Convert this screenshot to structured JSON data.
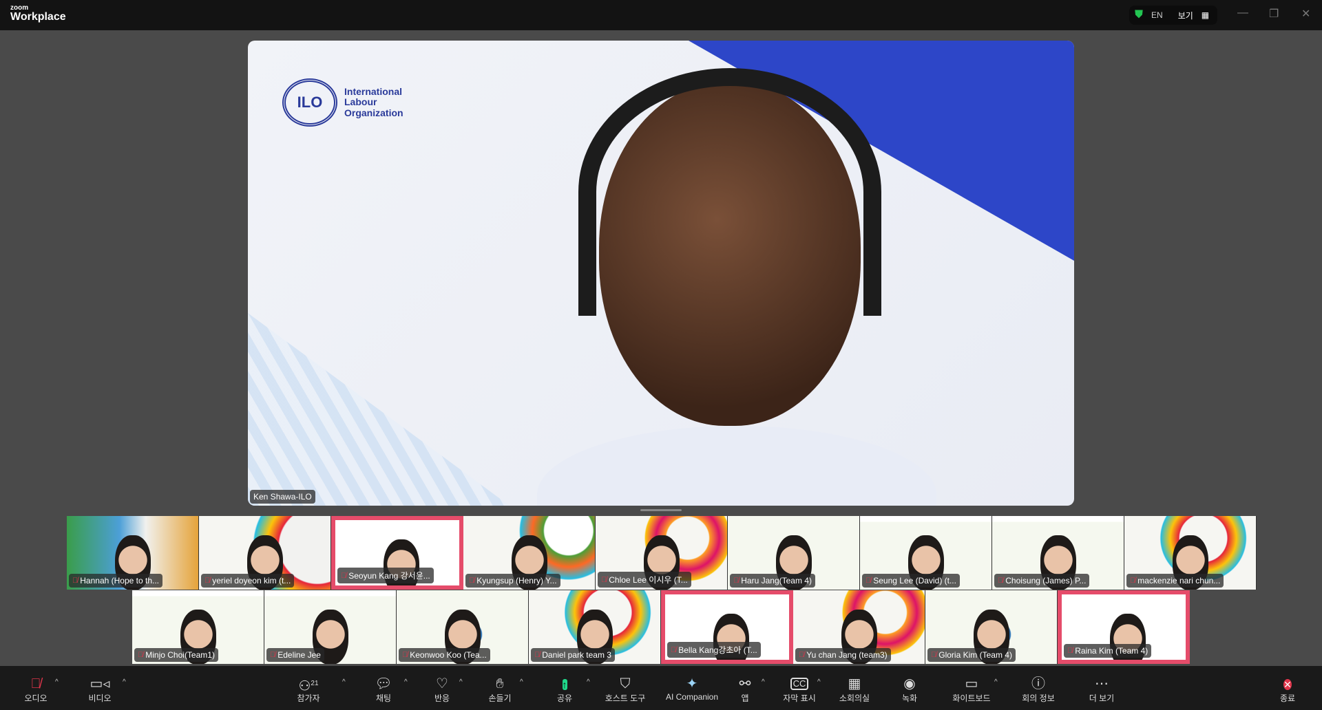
{
  "titlebar": {
    "brand_small": "zoom",
    "brand": "Workplace",
    "language": "EN",
    "view_label": "보기"
  },
  "speaker": {
    "name": "Ken Shawa-ILO",
    "org": [
      "International",
      "Labour",
      "Organization"
    ],
    "org_seal": "ILO"
  },
  "thumbnails_row1": [
    {
      "name": "Hannah (Hope to th..."
    },
    {
      "name": "yeriel doyeon kim (t..."
    },
    {
      "name": "Seoyun Kang 강서윤..."
    },
    {
      "name": "Kyungsup (Henry) Y..."
    },
    {
      "name": "Chloe Lee 이시우 (T..."
    },
    {
      "name": "Haru Jang(Team 4)"
    },
    {
      "name": "Seung Lee (David) (t..."
    },
    {
      "name": "Choisung (James) P..."
    },
    {
      "name": "mackenzie nari chun..."
    }
  ],
  "thumbnails_row2": [
    {
      "name": "Minjo Choi(Team1)"
    },
    {
      "name": "Edeline Jee"
    },
    {
      "name": "Keonwoo Koo (Tea..."
    },
    {
      "name": "Daniel park team 3"
    },
    {
      "name": "Bella Kang강초아 (T..."
    },
    {
      "name": "Yu chan Jang (team3)"
    },
    {
      "name": "Gloria Kim (Team 4)"
    },
    {
      "name": "Raina Kim (Team 4)"
    }
  ],
  "toolbar": {
    "audio": "오디오",
    "video": "비디오",
    "participants": "참가자",
    "participant_count": "21",
    "chat": "채팅",
    "reactions": "반응",
    "raise_hand": "손들기",
    "share": "공유",
    "host_tools": "호스트 도구",
    "ai_companion": "AI Companion",
    "apps": "앱",
    "captions": "자막 표시",
    "breakout": "소회의실",
    "record": "녹화",
    "whiteboard": "화이트보드",
    "meeting_info": "회의 정보",
    "more": "더 보기",
    "end": "종료"
  }
}
